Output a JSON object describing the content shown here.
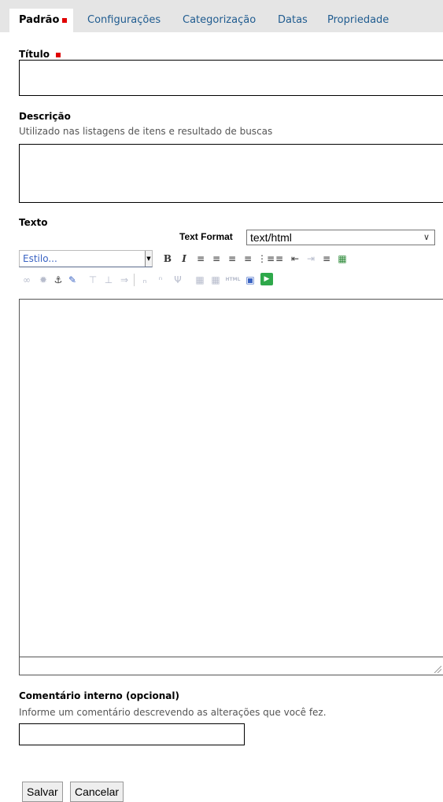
{
  "tabs": [
    {
      "label": "Padrão",
      "active": true,
      "required": true
    },
    {
      "label": "Configurações"
    },
    {
      "label": "Categorização"
    },
    {
      "label": "Datas"
    },
    {
      "label": "Propriedade"
    }
  ],
  "fields": {
    "title_label": "Título",
    "title_value": "",
    "description_label": "Descrição",
    "description_help": "Utilizado nas listagens de itens e resultado de buscas",
    "description_value": "",
    "text_label": "Texto",
    "comment_label": "Comentário interno (opcional)",
    "comment_help": "Informe um comentário descrevendo as alterações que você fez.",
    "comment_value": ""
  },
  "editor": {
    "text_format_label": "Text Format",
    "text_format_value": "text/html",
    "style_placeholder": "Estilo...",
    "html_button": "HTML",
    "content": ""
  },
  "buttons": {
    "save": "Salvar",
    "cancel": "Cancelar"
  },
  "colors": {
    "tab_link": "#205c90",
    "required": "#e00000",
    "tabbar_bg": "#e5e5e5"
  }
}
